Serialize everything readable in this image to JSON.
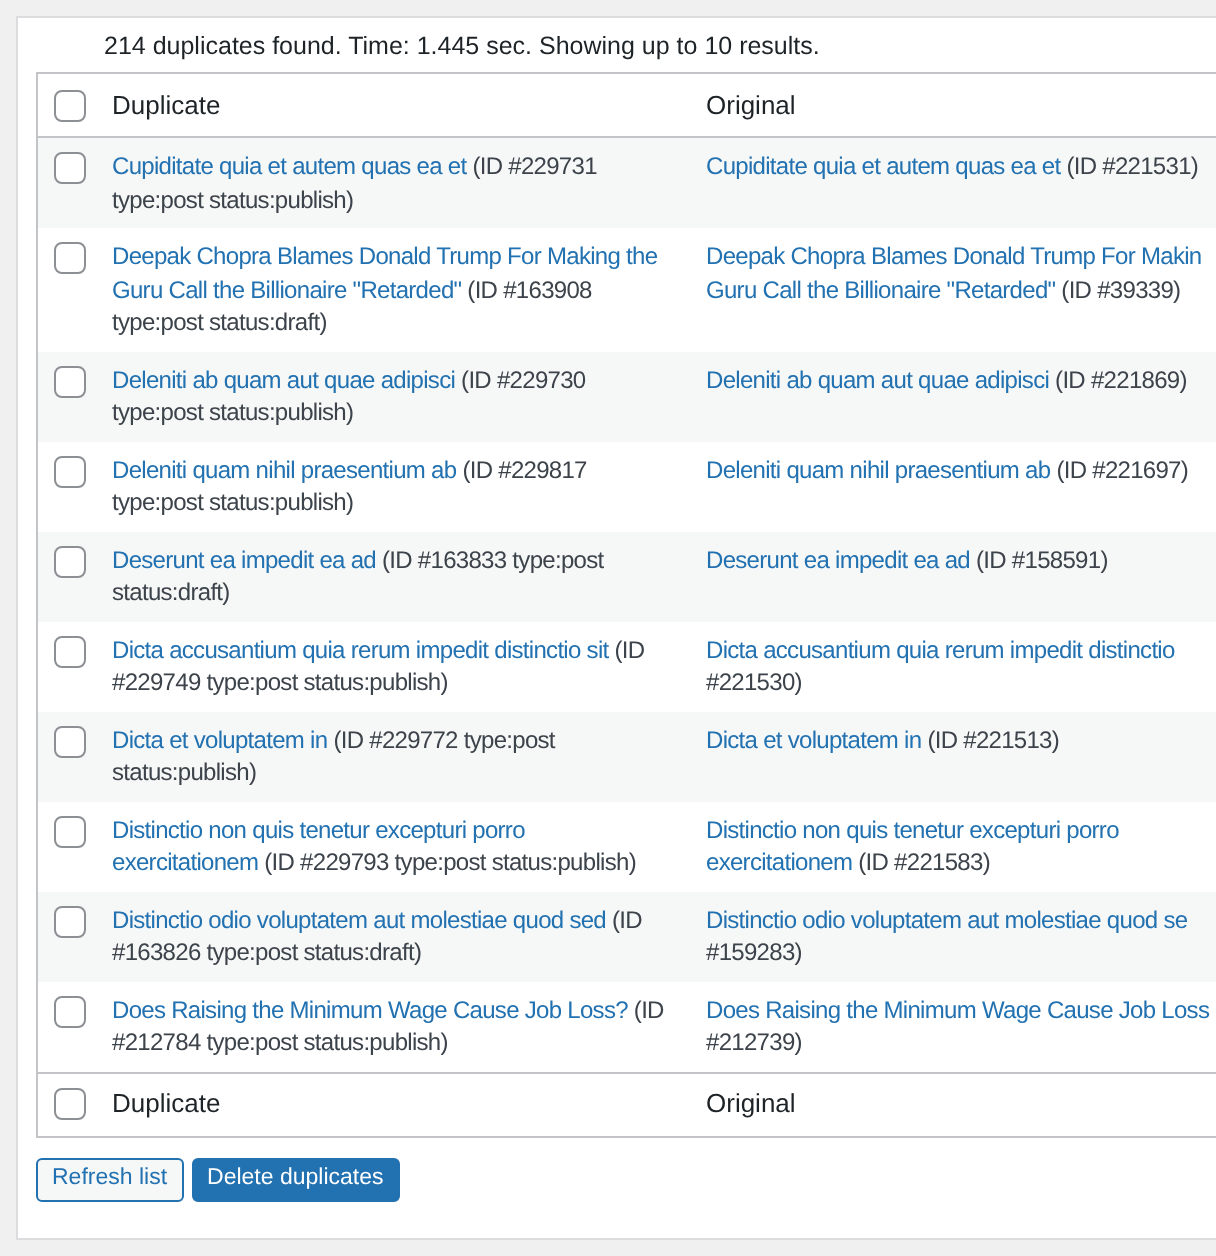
{
  "summary": "214 duplicates found. Time: 1.445 sec. Showing up to 10 results.",
  "table": {
    "header": {
      "checked": false,
      "columns": [
        "Duplicate",
        "Original"
      ]
    },
    "rows": [
      {
        "checked": false,
        "duplicate": [
          {
            "link": "Cupiditate quia et autem quas ea et",
            "text": "(ID #229731"
          },
          {
            "text": "type:post status:publish)"
          }
        ],
        "original": [
          {
            "link": "Cupiditate quia et autem quas ea et",
            "text": "(ID #221531)"
          }
        ]
      },
      {
        "checked": false,
        "duplicate": [
          {
            "link": "Deepak Chopra Blames Donald Trump For Making the"
          },
          {
            "link": "Guru Call the Billionaire \"Retarded\"",
            "text": "(ID #163908"
          },
          {
            "text": "type:post status:draft)"
          }
        ],
        "original": [
          {
            "link": "Deepak Chopra Blames Donald Trump For Makin"
          },
          {
            "link": "Guru Call the Billionaire \"Retarded\"",
            "text": "(ID #39339)"
          }
        ]
      },
      {
        "checked": false,
        "duplicate": [
          {
            "link": "Deleniti ab quam aut quae adipisci",
            "text": "(ID #229730"
          },
          {
            "text": "type:post status:publish)"
          }
        ],
        "original": [
          {
            "link": "Deleniti ab quam aut quae adipisci",
            "text": "(ID #221869)"
          }
        ]
      },
      {
        "checked": false,
        "duplicate": [
          {
            "link": "Deleniti quam nihil praesentium ab",
            "text": "(ID #229817"
          },
          {
            "text": "type:post status:publish)"
          }
        ],
        "original": [
          {
            "link": "Deleniti quam nihil praesentium ab",
            "text": "(ID #221697)"
          }
        ]
      },
      {
        "checked": false,
        "duplicate": [
          {
            "link": "Deserunt ea impedit ea ad",
            "text": "(ID #163833 type:post"
          },
          {
            "text": "status:draft)"
          }
        ],
        "original": [
          {
            "link": "Deserunt ea impedit ea ad",
            "text": "(ID #158591)"
          }
        ]
      },
      {
        "checked": false,
        "duplicate": [
          {
            "link": "Dicta accusantium quia rerum impedit distinctio sit",
            "text": "(ID"
          },
          {
            "text": "#229749 type:post status:publish)"
          }
        ],
        "original": [
          {
            "link": "Dicta accusantium quia rerum impedit distinctio"
          },
          {
            "text": "#221530)"
          }
        ]
      },
      {
        "checked": false,
        "duplicate": [
          {
            "link": "Dicta et voluptatem in",
            "text": "(ID #229772 type:post"
          },
          {
            "text": "status:publish)"
          }
        ],
        "original": [
          {
            "link": "Dicta et voluptatem in",
            "text": "(ID #221513)"
          }
        ]
      },
      {
        "checked": false,
        "duplicate": [
          {
            "link": "Distinctio non quis tenetur excepturi porro"
          },
          {
            "link": "exercitationem",
            "text": "(ID #229793 type:post status:publish)"
          }
        ],
        "original": [
          {
            "link": "Distinctio non quis tenetur excepturi porro"
          },
          {
            "link": "exercitationem",
            "text": "(ID #221583)"
          }
        ]
      },
      {
        "checked": false,
        "duplicate": [
          {
            "link": "Distinctio odio voluptatem aut molestiae quod sed",
            "text": "(ID"
          },
          {
            "text": "#163826 type:post status:draft)"
          }
        ],
        "original": [
          {
            "link": "Distinctio odio voluptatem aut molestiae quod se"
          },
          {
            "text": "#159283)"
          }
        ]
      },
      {
        "checked": false,
        "duplicate": [
          {
            "link": "Does Raising the Minimum Wage Cause Job Loss?",
            "text": "(ID"
          },
          {
            "text": "#212784 type:post status:publish)"
          }
        ],
        "original": [
          {
            "link": "Does Raising the Minimum Wage Cause Job Loss"
          },
          {
            "text": "#212739)"
          }
        ]
      }
    ],
    "footer": {
      "checked": false,
      "columns": [
        "Duplicate",
        "Original"
      ]
    }
  },
  "buttons": [
    {
      "label": "Refresh list",
      "kind": "secondary"
    },
    {
      "label": "Delete duplicates",
      "kind": "primary"
    }
  ]
}
